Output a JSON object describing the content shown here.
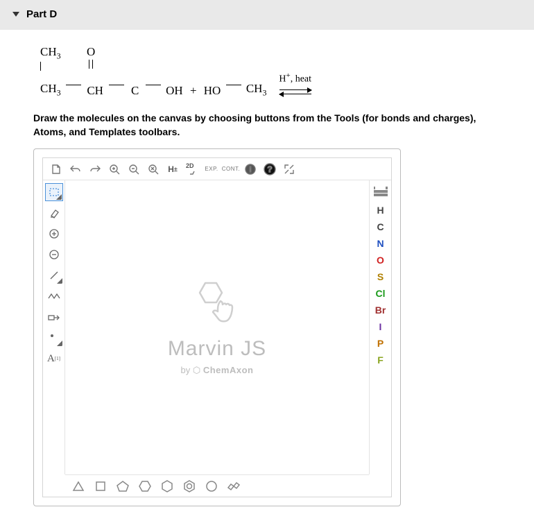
{
  "part": {
    "label": "Part D"
  },
  "reaction": {
    "g1_top": "CH",
    "g1_top_sub": "3",
    "g2_top": "O",
    "l1": "CH",
    "l1_sub": "3",
    "l2": "CH",
    "l3": "C",
    "l4": "OH",
    "plus": "+",
    "r1": "HO",
    "r2": "CH",
    "r2_sub": "3",
    "cond_h": "H",
    "cond_sup": "+",
    "cond_rest": ", heat"
  },
  "instructions": "Draw the molecules on the canvas by choosing buttons from the Tools (for bonds and charges), Atoms, and Templates toolbars.",
  "topbar": {
    "hplus": "H",
    "hpm": "±",
    "twod": "2D",
    "exp": "EXP.",
    "cont": "CONT."
  },
  "left": {
    "any": "A",
    "any_sup": "[1]"
  },
  "atoms": [
    "H",
    "C",
    "N",
    "O",
    "S",
    "Cl",
    "Br",
    "I",
    "P",
    "F"
  ],
  "atom_colors": [
    "#444",
    "#444",
    "#2050c0",
    "#d02020",
    "#b08000",
    "#1a9a1a",
    "#a03030",
    "#6a2fa0",
    "#c07000",
    "#8aa520"
  ],
  "branding": {
    "name": "Marvin JS",
    "by": "by",
    "company": "ChemAxon"
  }
}
